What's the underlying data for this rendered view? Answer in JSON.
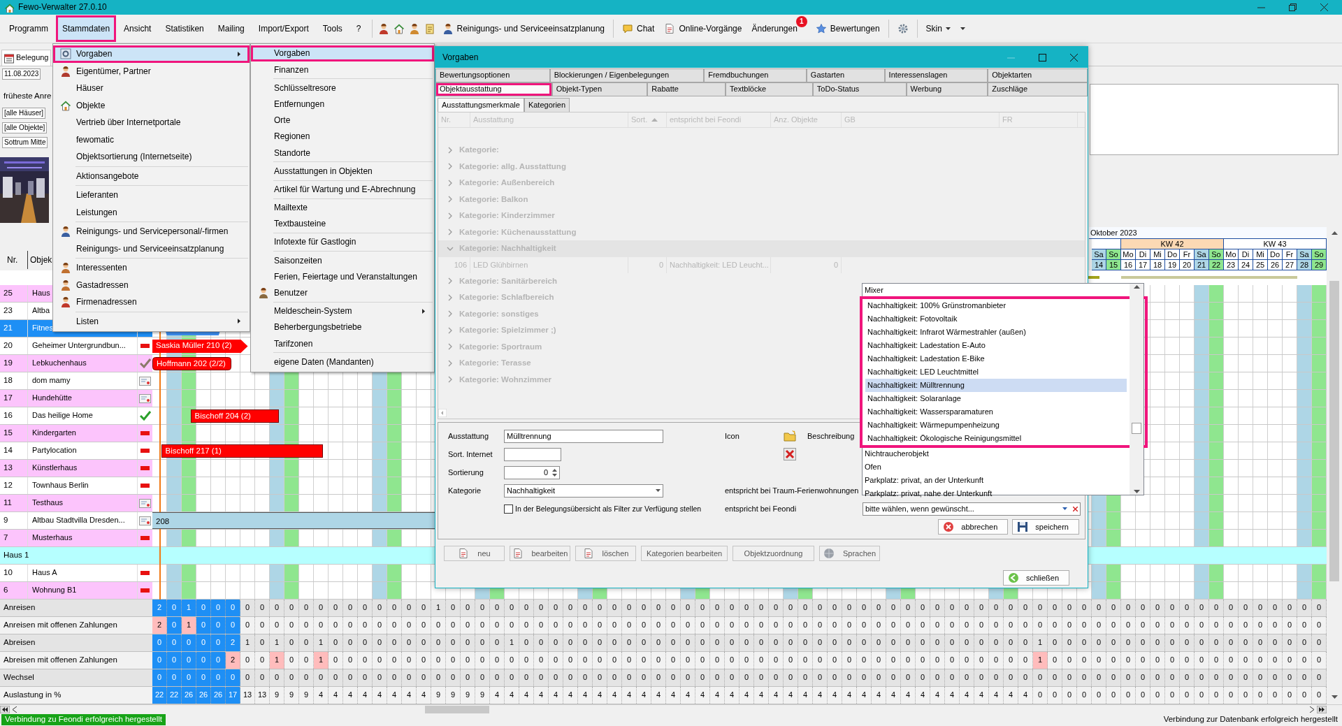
{
  "window": {
    "title": "Fewo-Verwalter 27.0.10"
  },
  "menubar": [
    {
      "label": "Programm",
      "open": false,
      "annotated": false
    },
    {
      "label": "Stammdaten",
      "open": true,
      "annotated": true
    },
    {
      "label": "Ansicht",
      "open": false,
      "annotated": false
    },
    {
      "label": "Statistiken",
      "open": false,
      "annotated": false
    },
    {
      "label": "Mailing",
      "open": false,
      "annotated": false
    },
    {
      "label": "Import/Export",
      "open": false,
      "annotated": false
    },
    {
      "label": "Tools",
      "open": false,
      "annotated": false
    },
    {
      "label": "?",
      "open": false,
      "annotated": false
    }
  ],
  "toolbar": [
    {
      "label": "Reinigungs- und Serviceeinsatzplanung"
    },
    {
      "label": "Chat"
    },
    {
      "label": "Online-Vorgänge"
    },
    {
      "label": "Änderungen",
      "badge": "1"
    },
    {
      "label": "Bewertungen"
    },
    {
      "label": "Skin"
    }
  ],
  "left_panel": {
    "tab": "Belegung",
    "date": "11.08.2023",
    "earliest_label": "früheste Anre",
    "filters": [
      "[alle Häuser]",
      "[alle Objekte]",
      "Sottrum Mitte"
    ],
    "photo": {
      "kind": "picture"
    },
    "columns": [
      "Nr.",
      "Objek"
    ]
  },
  "stammdaten_menu": {
    "items": [
      {
        "kind": "item",
        "label": "Vorgaben",
        "selected": true,
        "annotated": true,
        "arrow": true
      },
      {
        "kind": "item",
        "label": "Eigentümer, Partner",
        "selected": false,
        "annotated": false,
        "arrow": false
      },
      {
        "kind": "item",
        "label": "Häuser",
        "selected": false,
        "annotated": false,
        "arrow": false
      },
      {
        "kind": "item",
        "label": "Objekte",
        "selected": false,
        "annotated": false,
        "arrow": false
      },
      {
        "kind": "item",
        "label": "Vertrieb über Internetportale",
        "selected": false,
        "annotated": false,
        "arrow": false
      },
      {
        "kind": "item",
        "label": "fewomatic",
        "selected": false,
        "annotated": false,
        "arrow": false
      },
      {
        "kind": "item",
        "label": "Objektsortierung (Internetseite)",
        "selected": false,
        "annotated": false,
        "arrow": false
      },
      {
        "kind": "separator"
      },
      {
        "kind": "item",
        "label": "Aktionsangebote",
        "selected": false,
        "annotated": false,
        "arrow": false
      },
      {
        "kind": "separator"
      },
      {
        "kind": "item",
        "label": "Lieferanten",
        "selected": false,
        "annotated": false,
        "arrow": false
      },
      {
        "kind": "item",
        "label": "Leistungen",
        "selected": false,
        "annotated": false,
        "arrow": false
      },
      {
        "kind": "separator"
      },
      {
        "kind": "item",
        "label": "Reinigungs- und Servicepersonal/-firmen",
        "selected": false,
        "annotated": false,
        "arrow": false
      },
      {
        "kind": "item",
        "label": "Reinigungs- und Serviceeinsatzplanung",
        "selected": false,
        "annotated": false,
        "arrow": false
      },
      {
        "kind": "separator"
      },
      {
        "kind": "item",
        "label": "Interessenten",
        "selected": false,
        "annotated": false,
        "arrow": false
      },
      {
        "kind": "item",
        "label": "Gastadressen",
        "selected": false,
        "annotated": false,
        "arrow": false
      },
      {
        "kind": "item",
        "label": "Firmenadressen",
        "selected": false,
        "annotated": false,
        "arrow": false
      },
      {
        "kind": "separator"
      },
      {
        "kind": "item",
        "label": "Listen",
        "selected": false,
        "annotated": false,
        "arrow": true
      }
    ],
    "submenu": [
      {
        "kind": "item",
        "label": "Vorgaben",
        "selected": true,
        "annotated": true,
        "arrow": false
      },
      {
        "kind": "item",
        "label": "Finanzen",
        "selected": false,
        "annotated": false,
        "arrow": false
      },
      {
        "kind": "separator"
      },
      {
        "kind": "item",
        "label": "Schlüsseltresore",
        "selected": false,
        "annotated": false,
        "arrow": false
      },
      {
        "kind": "item",
        "label": "Entfernungen",
        "selected": false,
        "annotated": false,
        "arrow": false
      },
      {
        "kind": "item",
        "label": "Orte",
        "selected": false,
        "annotated": false,
        "arrow": false
      },
      {
        "kind": "item",
        "label": "Regionen",
        "selected": false,
        "annotated": false,
        "arrow": false
      },
      {
        "kind": "item",
        "label": "Standorte",
        "selected": false,
        "annotated": false,
        "arrow": false
      },
      {
        "kind": "separator"
      },
      {
        "kind": "item",
        "label": "Ausstattungen in Objekten",
        "selected": false,
        "annotated": false,
        "arrow": false
      },
      {
        "kind": "separator"
      },
      {
        "kind": "item",
        "label": "Artikel für Wartung und E-Abrechnung",
        "selected": false,
        "annotated": false,
        "arrow": false
      },
      {
        "kind": "separator"
      },
      {
        "kind": "item",
        "label": "Mailtexte",
        "selected": false,
        "annotated": false,
        "arrow": false
      },
      {
        "kind": "item",
        "label": "Textbausteine",
        "selected": false,
        "annotated": false,
        "arrow": false
      },
      {
        "kind": "separator"
      },
      {
        "kind": "item",
        "label": "Infotexte für Gastlogin",
        "selected": false,
        "annotated": false,
        "arrow": false
      },
      {
        "kind": "separator"
      },
      {
        "kind": "item",
        "label": "Saisonzeiten",
        "selected": false,
        "annotated": false,
        "arrow": false
      },
      {
        "kind": "item",
        "label": "Ferien, Feiertage und Veranstaltungen",
        "selected": false,
        "annotated": false,
        "arrow": false
      },
      {
        "kind": "item",
        "label": "Benutzer",
        "selected": false,
        "annotated": false,
        "arrow": false
      },
      {
        "kind": "separator"
      },
      {
        "kind": "item",
        "label": "Meldeschein-System",
        "selected": false,
        "annotated": false,
        "arrow": true
      },
      {
        "kind": "item",
        "label": "Beherbergungsbetriebe",
        "selected": false,
        "annotated": false,
        "arrow": false
      },
      {
        "kind": "item",
        "label": "Tarifzonen",
        "selected": false,
        "annotated": false,
        "arrow": false
      },
      {
        "kind": "separator"
      },
      {
        "kind": "item",
        "label": "eigene Daten (Mandanten)",
        "selected": false,
        "annotated": false,
        "arrow": false
      }
    ]
  },
  "schedule": {
    "month": "Oktober 2023",
    "weeks": [
      {
        "label": "KW 42",
        "current": true
      },
      {
        "label": "KW 43",
        "current": false
      }
    ],
    "days": [
      {
        "kind": "weekday",
        "selected": true
      },
      {
        "kind": "saturday",
        "selected": true
      },
      {
        "kind": "sunday",
        "selected": true
      },
      {
        "kind": "weekday",
        "selected": true
      },
      {
        "kind": "weekday",
        "selected": true
      },
      {
        "kind": "weekday",
        "selected": true
      },
      {
        "kind": "weekday",
        "selected": false
      },
      {
        "kind": "weekday",
        "selected": false
      },
      {
        "kind": "saturday",
        "selected": false
      },
      {
        "kind": "sunday",
        "selected": false
      },
      {
        "kind": "weekday",
        "selected": false
      },
      {
        "kind": "weekday",
        "selected": false
      },
      {
        "kind": "weekday",
        "selected": false
      },
      {
        "kind": "weekday",
        "selected": false
      },
      {
        "kind": "weekday",
        "selected": false
      },
      {
        "kind": "saturday",
        "selected": false
      },
      {
        "kind": "sunday",
        "selected": false
      },
      {
        "kind": "weekday",
        "selected": false
      },
      {
        "kind": "weekday",
        "selected": false
      },
      {
        "kind": "weekday",
        "selected": false
      },
      {
        "kind": "weekday",
        "selected": false
      },
      {
        "kind": "weekday",
        "selected": false
      },
      {
        "kind": "saturday",
        "selected": false
      },
      {
        "kind": "sunday",
        "selected": false
      },
      {
        "kind": "weekday",
        "selected": false
      },
      {
        "kind": "weekday",
        "selected": false
      },
      {
        "kind": "weekday",
        "selected": false
      },
      {
        "kind": "weekday",
        "selected": false
      },
      {
        "kind": "weekday",
        "selected": false
      },
      {
        "kind": "saturday",
        "selected": false
      },
      {
        "kind": "sunday",
        "selected": false
      },
      {
        "kind": "weekday",
        "selected": false
      },
      {
        "kind": "weekday",
        "selected": false
      },
      {
        "kind": "weekday",
        "selected": false
      },
      {
        "kind": "weekday",
        "selected": false
      },
      {
        "kind": "weekday",
        "selected": false
      },
      {
        "kind": "saturday",
        "selected": false
      },
      {
        "kind": "sunday",
        "selected": false
      },
      {
        "kind": "weekday",
        "selected": false
      },
      {
        "kind": "weekday",
        "selected": false
      },
      {
        "kind": "weekday",
        "selected": false
      },
      {
        "kind": "weekday",
        "selected": false
      },
      {
        "kind": "weekday",
        "selected": false
      },
      {
        "kind": "saturday",
        "selected": false
      },
      {
        "kind": "sunday",
        "selected": false
      },
      {
        "kind": "weekday",
        "selected": false
      },
      {
        "kind": "weekday",
        "selected": false
      },
      {
        "kind": "weekday",
        "selected": false
      },
      {
        "kind": "weekday",
        "selected": false
      },
      {
        "kind": "weekday",
        "selected": false
      },
      {
        "kind": "saturday",
        "selected": false
      },
      {
        "kind": "sunday",
        "selected": false
      },
      {
        "kind": "weekday",
        "selected": false
      },
      {
        "kind": "weekday",
        "selected": false
      },
      {
        "kind": "weekday",
        "selected": false
      },
      {
        "kind": "weekday",
        "selected": false
      },
      {
        "kind": "weekday",
        "selected": false
      },
      {
        "kind": "saturday",
        "selected": false
      },
      {
        "kind": "sunday",
        "selected": false
      },
      {
        "kind": "weekday",
        "selected": false
      },
      {
        "kind": "weekday",
        "selected": false
      },
      {
        "kind": "weekday",
        "selected": false
      },
      {
        "kind": "weekday",
        "selected": false
      },
      {
        "kind": "weekday",
        "selected": false
      },
      {
        "kind": "saturday",
        "selected": false,
        "weekday": "Sa",
        "date": "14"
      },
      {
        "kind": "sunday",
        "selected": false,
        "weekday": "So",
        "date": "15"
      },
      {
        "kind": "weekday",
        "selected": false,
        "weekday": "Mo",
        "date": "16"
      },
      {
        "kind": "weekday",
        "selected": false,
        "weekday": "Di",
        "date": "17"
      },
      {
        "kind": "weekday",
        "selected": false,
        "weekday": "Mi",
        "date": "18"
      },
      {
        "kind": "weekday",
        "selected": false,
        "weekday": "Do",
        "date": "19"
      },
      {
        "kind": "weekday",
        "selected": false,
        "weekday": "Fr",
        "date": "20"
      },
      {
        "kind": "saturday",
        "selected": false,
        "weekday": "Sa",
        "date": "21"
      },
      {
        "kind": "sunday",
        "selected": false,
        "weekday": "So",
        "date": "22"
      },
      {
        "kind": "weekday",
        "selected": false,
        "weekday": "Mo",
        "date": "23"
      },
      {
        "kind": "weekday",
        "selected": false,
        "weekday": "Di",
        "date": "24"
      },
      {
        "kind": "weekday",
        "selected": false,
        "weekday": "Mi",
        "date": "25"
      },
      {
        "kind": "weekday",
        "selected": false,
        "weekday": "Do",
        "date": "26"
      },
      {
        "kind": "weekday",
        "selected": false,
        "weekday": "Fr",
        "date": "27"
      },
      {
        "kind": "saturday",
        "selected": false,
        "weekday": "Sa",
        "date": "28"
      },
      {
        "kind": "sunday",
        "selected": false,
        "weekday": "So",
        "date": "29"
      }
    ],
    "rows": [
      {
        "kind": "object",
        "nr": "25",
        "name": "Haus",
        "tinted": true,
        "selected": false
      },
      {
        "kind": "object",
        "nr": "23",
        "name": "Altba",
        "tinted": false,
        "selected": false
      },
      {
        "kind": "object",
        "nr": "21",
        "name": "Fitnes",
        "selected": true,
        "bookings": [
          {
            "color": "#3d8ef0",
            "kind": "trapezoid"
          }
        ]
      },
      {
        "kind": "object",
        "nr": "20",
        "name": "Geheimer Untergrundbun...",
        "tinted": false,
        "selected": false,
        "status": {
          "kind": "minus"
        },
        "bookings": [
          {
            "text": "Saskia Müller 210 (2)",
            "color": "#ff0000",
            "kind": "arrow"
          }
        ]
      },
      {
        "kind": "object",
        "nr": "19",
        "name": "Lebkuchenhaus",
        "tinted": true,
        "selected": false,
        "status": {
          "kind": "check_grey"
        },
        "bookings": [
          {
            "text": "Hoffmann 202 (2/2)",
            "color": "#ff0000",
            "kind": "rounded"
          }
        ]
      },
      {
        "kind": "object",
        "nr": "18",
        "name": "dom mamy",
        "tinted": false,
        "selected": false,
        "status": {
          "kind": "card"
        }
      },
      {
        "kind": "object",
        "nr": "17",
        "name": "Hundehütte",
        "tinted": true,
        "selected": false,
        "status": {
          "kind": "card"
        }
      },
      {
        "kind": "object",
        "nr": "16",
        "name": "Das heilige Home",
        "tinted": false,
        "selected": false,
        "status": {
          "kind": "check"
        },
        "bookings": [
          {
            "text": "Bischoff 204 (2)",
            "color": "#ff0000",
            "kind": "plain"
          }
        ]
      },
      {
        "kind": "object",
        "nr": "15",
        "name": "Kindergarten",
        "tinted": true,
        "selected": false,
        "status": {
          "kind": "minus"
        }
      },
      {
        "kind": "object",
        "nr": "14",
        "name": "Partylocation",
        "tinted": false,
        "selected": false,
        "status": {
          "kind": "minus"
        },
        "bookings": [
          {
            "text": "Bischoff 217 (1)",
            "color": "#ff0000",
            "kind": "plain"
          }
        ]
      },
      {
        "kind": "object",
        "nr": "13",
        "name": "Künstlerhaus",
        "tinted": true,
        "selected": false,
        "status": {
          "kind": "minus"
        }
      },
      {
        "kind": "object",
        "nr": "12",
        "name": "Townhaus Berlin",
        "tinted": false,
        "selected": false,
        "status": {
          "kind": "minus"
        }
      },
      {
        "kind": "object",
        "nr": "11",
        "name": "Testhaus",
        "tinted": true,
        "selected": false,
        "status": {
          "kind": "card"
        }
      },
      {
        "kind": "object",
        "nr": "9",
        "name": "Altbau Stadtvilla Dresden...",
        "tinted": false,
        "selected": false,
        "status": {
          "kind": "card"
        },
        "bookings": [
          {
            "text": "208",
            "color": "#aed6e6",
            "kind": "band"
          }
        ]
      },
      {
        "kind": "object",
        "nr": "7",
        "name": "Musterhaus",
        "tinted": true,
        "selected": false,
        "status": {
          "kind": "minus"
        }
      },
      {
        "kind": "group",
        "name": "Haus 1"
      },
      {
        "kind": "object",
        "nr": "10",
        "name": "Haus A",
        "tinted": false,
        "selected": false,
        "status": {
          "kind": "minus"
        }
      },
      {
        "kind": "object",
        "nr": "6",
        "name": "Wohnung B1",
        "tinted": true,
        "selected": false,
        "status": {
          "kind": "minus"
        }
      }
    ],
    "stats": [
      {
        "label": "Anreisen",
        "values": [
          "2",
          "0",
          "1",
          "0",
          "0",
          "0",
          "0",
          "0",
          "0",
          "0",
          "0",
          "0",
          "0",
          "0",
          "0",
          "0",
          "0",
          "0",
          "0",
          "1",
          "0",
          "0",
          "0",
          "0",
          "0",
          "0",
          "0",
          "0",
          "0",
          "0",
          "0",
          "0",
          "0",
          "0",
          "0",
          "0",
          "0",
          "0",
          "0",
          "0",
          "0",
          "0",
          "0",
          "0",
          "0",
          "0",
          "0",
          "0",
          "0",
          "0",
          "0",
          "0",
          "0",
          "0",
          "0",
          "0",
          "0",
          "0",
          "0",
          "0",
          "0",
          "0",
          "0",
          "0",
          "0",
          "0",
          "0",
          "0",
          "0",
          "0",
          "0",
          "0",
          "0",
          "0",
          "0",
          "0",
          "0",
          "0",
          "0",
          "0"
        ]
      },
      {
        "label": "Anreisen mit offenen Zahlungen",
        "values": [
          "2",
          "0",
          "1",
          "0",
          "0",
          "0",
          "0",
          "0",
          "0",
          "0",
          "0",
          "0",
          "0",
          "0",
          "0",
          "0",
          "0",
          "0",
          "0",
          "0",
          "0",
          "0",
          "0",
          "0",
          "0",
          "0",
          "0",
          "0",
          "0",
          "0",
          "0",
          "0",
          "0",
          "0",
          "0",
          "0",
          "0",
          "0",
          "0",
          "0",
          "0",
          "0",
          "0",
          "0",
          "0",
          "0",
          "0",
          "0",
          "0",
          "0",
          "0",
          "0",
          "0",
          "0",
          "0",
          "0",
          "0",
          "0",
          "0",
          "0",
          "0",
          "0",
          "0",
          "0",
          "0",
          "0",
          "0",
          "0",
          "0",
          "0",
          "0",
          "0",
          "0",
          "0",
          "0",
          "0",
          "0",
          "0",
          "0",
          "0"
        ],
        "flags": [
          true,
          false,
          true,
          false,
          false,
          false,
          false,
          false,
          false,
          false,
          false,
          false,
          false,
          false,
          false,
          false,
          false,
          false,
          false,
          false,
          false,
          false,
          false,
          false,
          false,
          false,
          false,
          false,
          false,
          false,
          false,
          false,
          false,
          false,
          false,
          false,
          false,
          false,
          false,
          false,
          false,
          false,
          false,
          false,
          false,
          false,
          false,
          false,
          false,
          false,
          false,
          false,
          false,
          false,
          false,
          false,
          false,
          false,
          false,
          false,
          false,
          false,
          false,
          false,
          false,
          false,
          false,
          false,
          false,
          false,
          false,
          false,
          false,
          false,
          false,
          false,
          false,
          false,
          false,
          false
        ]
      },
      {
        "label": "Abreisen",
        "values": [
          "0",
          "0",
          "0",
          "0",
          "0",
          "2",
          "1",
          "0",
          "1",
          "0",
          "0",
          "1",
          "0",
          "0",
          "0",
          "0",
          "0",
          "0",
          "0",
          "0",
          "0",
          "0",
          "0",
          "0",
          "1",
          "0",
          "0",
          "0",
          "0",
          "0",
          "0",
          "0",
          "0",
          "0",
          "0",
          "0",
          "0",
          "0",
          "0",
          "0",
          "0",
          "0",
          "0",
          "0",
          "0",
          "0",
          "0",
          "0",
          "0",
          "0",
          "0",
          "0",
          "0",
          "0",
          "0",
          "0",
          "0",
          "0",
          "0",
          "0",
          "1",
          "0",
          "0",
          "0",
          "0",
          "0",
          "0",
          "0",
          "0",
          "0",
          "0",
          "0",
          "0",
          "0",
          "0",
          "0",
          "0",
          "0",
          "0",
          "0"
        ]
      },
      {
        "label": "Abreisen mit offenen Zahlungen",
        "values": [
          "0",
          "0",
          "0",
          "0",
          "0",
          "2",
          "0",
          "0",
          "1",
          "0",
          "0",
          "1",
          "0",
          "0",
          "0",
          "0",
          "0",
          "0",
          "0",
          "0",
          "0",
          "0",
          "0",
          "0",
          "0",
          "0",
          "0",
          "0",
          "0",
          "0",
          "0",
          "0",
          "0",
          "0",
          "0",
          "0",
          "0",
          "0",
          "0",
          "0",
          "0",
          "0",
          "0",
          "0",
          "0",
          "0",
          "0",
          "0",
          "0",
          "0",
          "0",
          "0",
          "0",
          "0",
          "0",
          "0",
          "0",
          "0",
          "0",
          "0",
          "1",
          "0",
          "0",
          "0",
          "0",
          "0",
          "0",
          "0",
          "0",
          "0",
          "0",
          "0",
          "0",
          "0",
          "0",
          "0",
          "0",
          "0",
          "0",
          "0"
        ],
        "flags": [
          false,
          false,
          false,
          false,
          false,
          true,
          false,
          false,
          true,
          false,
          false,
          true,
          false,
          false,
          false,
          false,
          false,
          false,
          false,
          false,
          false,
          false,
          false,
          false,
          false,
          false,
          false,
          false,
          false,
          false,
          false,
          false,
          false,
          false,
          false,
          false,
          false,
          false,
          false,
          false,
          false,
          false,
          false,
          false,
          false,
          false,
          false,
          false,
          false,
          false,
          false,
          false,
          false,
          false,
          false,
          false,
          false,
          false,
          false,
          false,
          true,
          false,
          false,
          false,
          false,
          false,
          false,
          false,
          false,
          false,
          false,
          false,
          false,
          false,
          false,
          false,
          false,
          false,
          false,
          false
        ]
      },
      {
        "label": "Wechsel",
        "values": [
          "0",
          "0",
          "0",
          "0",
          "0",
          "0",
          "0",
          "0",
          "0",
          "0",
          "0",
          "0",
          "0",
          "0",
          "0",
          "0",
          "0",
          "0",
          "0",
          "0",
          "0",
          "0",
          "0",
          "0",
          "0",
          "0",
          "0",
          "0",
          "0",
          "0",
          "0",
          "0",
          "0",
          "0",
          "0",
          "0",
          "0",
          "0",
          "0",
          "0",
          "0",
          "0",
          "0",
          "0",
          "0",
          "0",
          "0",
          "0",
          "0",
          "0",
          "0",
          "0",
          "0",
          "0",
          "0",
          "0",
          "0",
          "0",
          "0",
          "0",
          "0",
          "0",
          "0",
          "0",
          "0",
          "0",
          "0",
          "0",
          "0",
          "0",
          "0",
          "0",
          "0",
          "0",
          "0",
          "0",
          "0",
          "0",
          "0",
          "0"
        ]
      },
      {
        "label": "Auslastung in %",
        "values": [
          "22",
          "22",
          "26",
          "26",
          "26",
          "17",
          "13",
          "13",
          "9",
          "9",
          "9",
          "4",
          "4",
          "4",
          "4",
          "4",
          "4",
          "4",
          "4",
          "9",
          "9",
          "9",
          "9",
          "4",
          "4",
          "4",
          "4",
          "4",
          "4",
          "4",
          "4",
          "4",
          "4",
          "4",
          "4",
          "4",
          "4",
          "4",
          "4",
          "4",
          "4",
          "4",
          "4",
          "4",
          "4",
          "4",
          "4",
          "4",
          "4",
          "4",
          "4",
          "4",
          "4",
          "4",
          "4",
          "4",
          "4",
          "4",
          "4",
          "4",
          "0",
          "0",
          "0",
          "0",
          "0",
          "0",
          "0",
          "0",
          "0",
          "0",
          "0",
          "0",
          "0",
          "0",
          "0",
          "0",
          "0",
          "0",
          "0",
          "0"
        ]
      }
    ]
  },
  "dialog": {
    "title": "Vorgaben",
    "tab_rows": [
      [
        {
          "label": "Bewertungsoptionen",
          "selected": false,
          "annotated": false
        },
        {
          "label": "Blockierungen / Eigenbelegungen",
          "selected": false,
          "annotated": false
        },
        {
          "label": "Fremdbuchungen",
          "selected": false,
          "annotated": false
        },
        {
          "label": "Gastarten",
          "selected": false,
          "annotated": false
        },
        {
          "label": "Interessenslagen",
          "selected": false,
          "annotated": false
        },
        {
          "label": "Objektarten",
          "selected": false,
          "annotated": false
        }
      ],
      [
        {
          "label": "Objektausstattung",
          "selected": true,
          "annotated": true
        },
        {
          "label": "Objekt-Typen",
          "selected": false,
          "annotated": false
        },
        {
          "label": "Rabatte",
          "selected": false,
          "annotated": false
        },
        {
          "label": "Textblöcke",
          "selected": false,
          "annotated": false
        },
        {
          "label": "ToDo-Status",
          "selected": false,
          "annotated": false
        },
        {
          "label": "Werbung",
          "selected": false,
          "annotated": false
        },
        {
          "label": "Zuschläge",
          "selected": false,
          "annotated": false
        }
      ]
    ],
    "subtabs": [
      {
        "label": "Ausstattungsmerkmale",
        "selected": true
      },
      {
        "label": "Kategorien",
        "selected": false
      }
    ],
    "grid": {
      "disabled": true,
      "columns": [
        {
          "label": "Nr.",
          "sorted": false
        },
        {
          "label": "Ausstattung",
          "sorted": false
        },
        {
          "label": "Sort.",
          "sorted": true
        },
        {
          "label": "entspricht bei Feondi",
          "sorted": false
        },
        {
          "label": "Anz. Objekte",
          "sorted": false
        },
        {
          "label": "GB",
          "sorted": false
        },
        {
          "label": "FR",
          "sorted": false
        }
      ],
      "groups": [
        {
          "label": "Kategorie:",
          "expanded": false
        },
        {
          "label": "Kategorie: allg. Ausstattung",
          "expanded": false
        },
        {
          "label": "Kategorie: Außenbereich",
          "expanded": false
        },
        {
          "label": "Kategorie: Balkon",
          "expanded": false
        },
        {
          "label": "Kategorie: Kinderzimmer",
          "expanded": false
        },
        {
          "label": "Kategorie: Küchenausstattung",
          "expanded": false
        },
        {
          "label": "Kategorie: Nachhaltigkeit",
          "expanded": true,
          "rows": [
            [
              "106",
              "LED Glühbirnen",
              "0",
              "Nachhaltigkeit: LED Leucht...",
              "0"
            ]
          ]
        },
        {
          "label": "Kategorie: Sanitärbereich",
          "expanded": false
        },
        {
          "label": "Kategorie: Schlafbereich",
          "expanded": false
        },
        {
          "label": "Kategorie: sonstiges",
          "expanded": false
        },
        {
          "label": "Kategorie: Spielzimmer ;)",
          "expanded": false
        },
        {
          "label": "Kategorie: Sportraum",
          "expanded": false
        },
        {
          "label": "Kategorie: Terasse",
          "expanded": false
        },
        {
          "label": "Kategorie: Wohnzimmer",
          "expanded": false
        }
      ]
    },
    "form": {
      "ausstattung": {
        "label": "Ausstattung",
        "value": "Mülltrennung"
      },
      "sort_internet": {
        "label": "Sort. Internet"
      },
      "sortierung": {
        "label": "Sortierung",
        "value": "0"
      },
      "kategorie": {
        "label": "Kategorie",
        "value": "Nachhaltigkeit"
      },
      "filter_checkbox": {
        "label": "In der Belegungsübersicht als Filter zur Verfügung stellen",
        "checked": false
      },
      "icon_label": "Icon",
      "description_label": "Beschreibung",
      "traum_label": "entspricht bei Traum-Ferienwohnungen",
      "feondi_label": "entspricht bei Feondi",
      "feondi_combo": {
        "value": "bitte wählen, wenn gewünscht..."
      },
      "buttons": [
        "abbrechen",
        "speichern"
      ]
    },
    "toolbar": [
      "neu",
      "bearbeiten",
      "löschen",
      "Kategorien bearbeiten",
      "Objektzuordnung",
      "Sprachen"
    ],
    "close_button": "schließen"
  },
  "dropdown": {
    "options": [
      {
        "label": "Mixer",
        "selected": false,
        "annotated": false
      },
      {
        "label": "Nachhaltigkeit: 100% Grünstromanbieter",
        "selected": false,
        "annotated": true
      },
      {
        "label": "Nachhaltigkeit: Fotovoltaik",
        "selected": false,
        "annotated": true
      },
      {
        "label": "Nachhaltigkeit: Infrarot Wärmestrahler (außen)",
        "selected": false,
        "annotated": true
      },
      {
        "label": "Nachhaltigkeit: Ladestation E-Auto",
        "selected": false,
        "annotated": true
      },
      {
        "label": "Nachhaltigkeit: Ladestation E-Bike",
        "selected": false,
        "annotated": true
      },
      {
        "label": "Nachhaltigkeit: LED Leuchtmittel",
        "selected": false,
        "annotated": true
      },
      {
        "label": "Nachhaltigkeit: Mülltrennung",
        "selected": true,
        "annotated": true
      },
      {
        "label": "Nachhaltigkeit: Solaranlage",
        "selected": false,
        "annotated": true
      },
      {
        "label": "Nachhaltigkeit: Wassersparamaturen",
        "selected": false,
        "annotated": true
      },
      {
        "label": "Nachhaltigkeit: Wärmepumpenheizung",
        "selected": false,
        "annotated": true
      },
      {
        "label": "Nachhaltigkeit: Ökologische Reinigungsmittel",
        "selected": false,
        "annotated": true
      },
      {
        "label": "Nichtraucherobjekt",
        "selected": false,
        "annotated": false
      },
      {
        "label": "Ofen",
        "selected": false,
        "annotated": false
      },
      {
        "label": "Parkplatz: privat, an der Unterkunft",
        "selected": false,
        "annotated": false
      },
      {
        "label": "Parkplatz: privat, nahe der Unterkunft",
        "selected": false,
        "annotated": false
      }
    ]
  },
  "status_bar": {
    "left": "Verbindung zu Feondi erfolgreich hergestellt",
    "right": "Verbindung zur Datenbank erfolgreich hergestellt"
  }
}
